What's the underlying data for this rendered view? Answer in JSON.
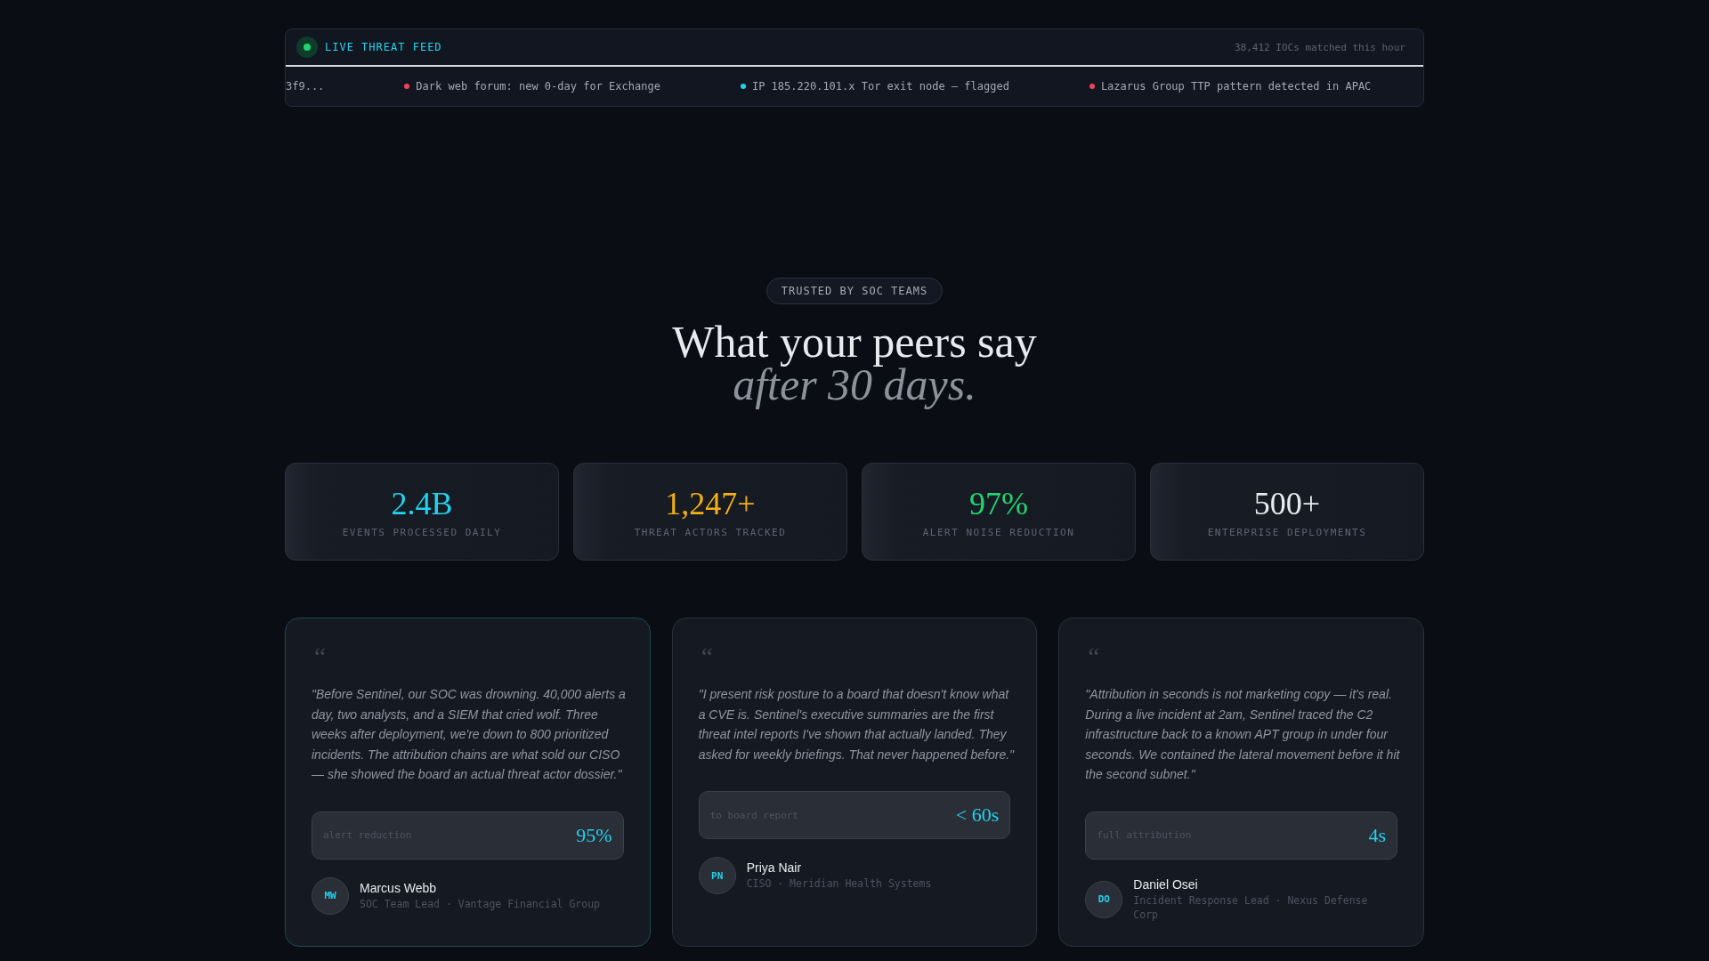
{
  "feed": {
    "title": "LIVE THREAT FEED",
    "live": true,
    "count": "38,412 IOCs matched this hour",
    "items": [
      {
        "text": "3f9..."
      },
      {
        "text": "Dark web forum: new 0-day for Exchange",
        "color": "#f43f5e"
      },
      {
        "text": "IP 185.220.101.x Tor exit node — flagged",
        "color": "#22d3ee"
      },
      {
        "text": "Lazarus Group TTP pattern detected in APAC",
        "color": "#f43f5e"
      }
    ]
  },
  "badge": "TRUSTED BY SOC TEAMS",
  "headline": {
    "line_1": "What your peers say",
    "line_2": "after 30 days."
  },
  "stats": [
    {
      "value": "2.4B",
      "label": "EVENTS PROCESSED DAILY",
      "color": "#22d3ee"
    },
    {
      "value": "1,247+",
      "label": "THREAT ACTORS TRACKED",
      "color": "#f5b014"
    },
    {
      "value": "97%",
      "label": "ALERT NOISE REDUCTION",
      "color": "#22d36e"
    },
    {
      "value": "500+",
      "label": "ENTERPRISE DEPLOYMENTS",
      "color": "#e8eaee"
    }
  ],
  "testimonials": [
    {
      "featured": true,
      "quote_mark": "“",
      "quote": "\"Before Sentinel, our SOC was drowning. 40,000 alerts a day, two analysts, and a SIEM that cried wolf. Three weeks after deployment, we're down to 800 prioritized incidents. The attribution chains are what sold our CISO — she showed the board an actual threat actor dossier.\"",
      "metric_label": "alert reduction",
      "metric_value": "95%",
      "initials": "MW",
      "name": "Marcus Webb",
      "role": "SOC Team Lead · Vantage Financial Group"
    },
    {
      "featured": false,
      "quote_mark": "“",
      "quote": "\"I present risk posture to a board that doesn't know what a CVE is. Sentinel's executive summaries are the first threat intel reports I've shown that actually landed. They asked for weekly briefings. That never happened before.\"",
      "metric_label": "to board report",
      "metric_value": "< 60s",
      "initials": "PN",
      "name": "Priya Nair",
      "role": "CISO · Meridian Health Systems"
    },
    {
      "featured": false,
      "quote_mark": "“",
      "quote": "\"Attribution in seconds is not marketing copy — it's real. During a live incident at 2am, Sentinel traced the C2 infrastructure back to a known APT group in under four seconds. We contained the lateral movement before it hit the second subnet.\"",
      "metric_label": "full attribution",
      "metric_value": "4s",
      "initials": "DO",
      "name": "Daniel Osei",
      "role": "Incident Response Lead · Nexus Defense Corp"
    }
  ]
}
